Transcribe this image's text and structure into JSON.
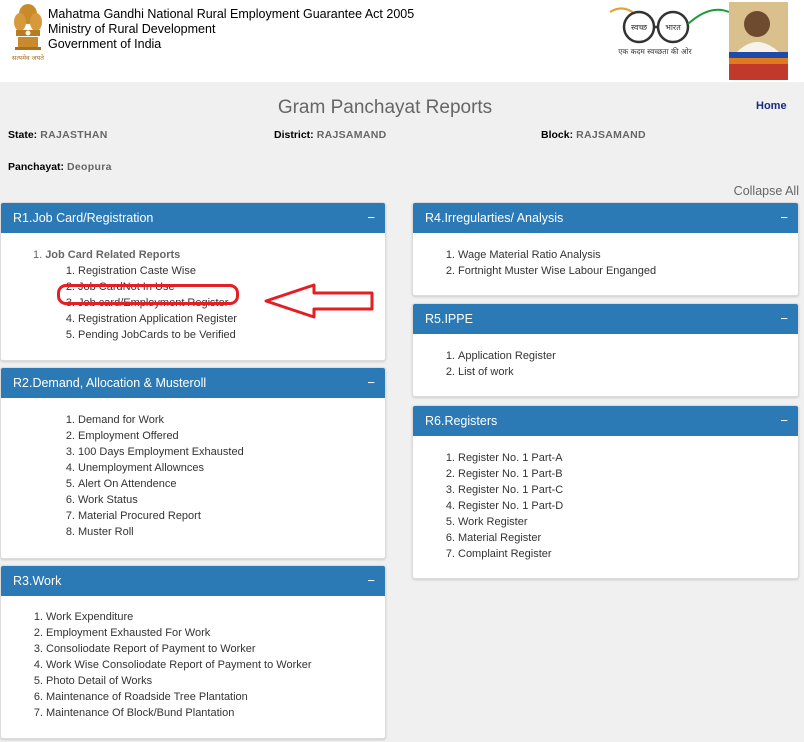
{
  "header": {
    "org_lines": [
      "Mahatma Gandhi National Rural Employment Guarantee Act 2005",
      "Ministry of Rural Development",
      "Government of India"
    ],
    "emblem_caption": "सत्यमेव जयते",
    "swachh_word1": "स्वच्छ",
    "swachh_word2": "भारत",
    "swachh_tagline": "एक कदम स्वच्छता की ओर"
  },
  "page": {
    "title": "Gram Panchayat Reports",
    "home_label": "Home",
    "collapse_all_label": "Collapse All"
  },
  "location": {
    "state_label": "State:",
    "state_value": "RAJASTHAN",
    "district_label": "District:",
    "district_value": "RAJSAMAND",
    "block_label": "Block:",
    "block_value": "RAJSAMAND",
    "panchayat_label": "Panchayat:",
    "panchayat_value": "Deopura"
  },
  "panels": {
    "r1": {
      "title": "R1.Job Card/Registration",
      "group_num": "1.",
      "group_title": "Job Card Related Reports",
      "items": [
        {
          "num": "1.",
          "label": "Registration Caste Wise"
        },
        {
          "num": "2.",
          "label": "Job CardNot In Use"
        },
        {
          "num": "3.",
          "label": "Job card/Employment Register"
        },
        {
          "num": "4.",
          "label": "Registration Application Register"
        },
        {
          "num": "5.",
          "label": "Pending JobCards to be Verified"
        }
      ]
    },
    "r2": {
      "title": "R2.Demand, Allocation & Musteroll",
      "items": [
        {
          "num": "1.",
          "label": "Demand for Work"
        },
        {
          "num": "2.",
          "label": "Employment Offered"
        },
        {
          "num": "3.",
          "label": "100 Days Employment Exhausted"
        },
        {
          "num": "4.",
          "label": "Unemployment Allownces"
        },
        {
          "num": "5.",
          "label": "Alert On Attendence"
        },
        {
          "num": "6.",
          "label": "Work Status"
        },
        {
          "num": "7.",
          "label": "Material Procured Report"
        },
        {
          "num": "8.",
          "label": "Muster Roll"
        }
      ]
    },
    "r3": {
      "title": "R3.Work",
      "items": [
        {
          "num": "1.",
          "label": "Work Expenditure"
        },
        {
          "num": "2.",
          "label": "Employment Exhausted For Work"
        },
        {
          "num": "3.",
          "label": "Consoliodate Report of Payment to Worker"
        },
        {
          "num": "4.",
          "label": "Work Wise Consoliodate Report of Payment to Worker"
        },
        {
          "num": "5.",
          "label": "Photo Detail of Works"
        },
        {
          "num": "6.",
          "label": "Maintenance of Roadside Tree Plantation"
        },
        {
          "num": "7.",
          "label": "Maintenance Of Block/Bund Plantation"
        }
      ]
    },
    "r4": {
      "title": "R4.Irregularties/ Analysis",
      "items": [
        {
          "num": "1.",
          "label": "Wage Material Ratio Analysis"
        },
        {
          "num": "2.",
          "label": "Fortnight Muster Wise Labour Enganged"
        }
      ]
    },
    "r5": {
      "title": "R5.IPPE",
      "items": [
        {
          "num": "1.",
          "label": "Application Register"
        },
        {
          "num": "2.",
          "label": "List of work"
        }
      ]
    },
    "r6": {
      "title": "R6.Registers",
      "items": [
        {
          "num": "1.",
          "label": "Register No. 1 Part-A"
        },
        {
          "num": "2.",
          "label": "Register No. 1 Part-B"
        },
        {
          "num": "3.",
          "label": "Register No. 1 Part-C"
        },
        {
          "num": "4.",
          "label": "Register No. 1 Part-D"
        },
        {
          "num": "5.",
          "label": "Work Register"
        },
        {
          "num": "6.",
          "label": "Material Register"
        },
        {
          "num": "7.",
          "label": "Complaint Register"
        }
      ]
    },
    "collapse_symbol": "−"
  },
  "colors": {
    "panel_header": "#2b7ab6",
    "highlight": "#e31e24",
    "home_link": "#1a2a80"
  }
}
